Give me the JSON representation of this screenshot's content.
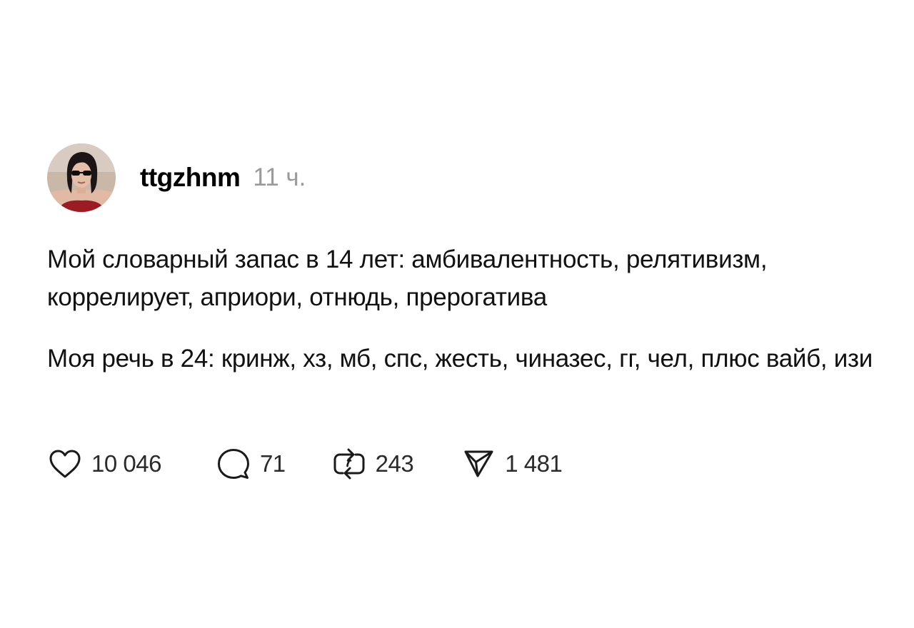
{
  "post": {
    "author": {
      "username": "ttgzhnm",
      "time": "11 ч."
    },
    "paragraphs": [
      "Мой словарный запас в 14 лет: амбивалентность, релятивизм, коррелирует, априори, отнюдь, прерогатива",
      "Моя речь в 24: кринж, хз, мб, спс, жесть, чиназес, гг, чел, плюс вайб, изи"
    ],
    "actions": {
      "like": {
        "icon": "heart-icon",
        "count": "10 046"
      },
      "reply": {
        "icon": "comment-icon",
        "count": "71"
      },
      "repost": {
        "icon": "repost-icon",
        "count": "243"
      },
      "share": {
        "icon": "send-icon",
        "count": "1 481"
      }
    }
  },
  "colors": {
    "text": "#111111",
    "muted": "#9a9a9a",
    "icon": "#1a1a1a",
    "background": "#ffffff"
  }
}
